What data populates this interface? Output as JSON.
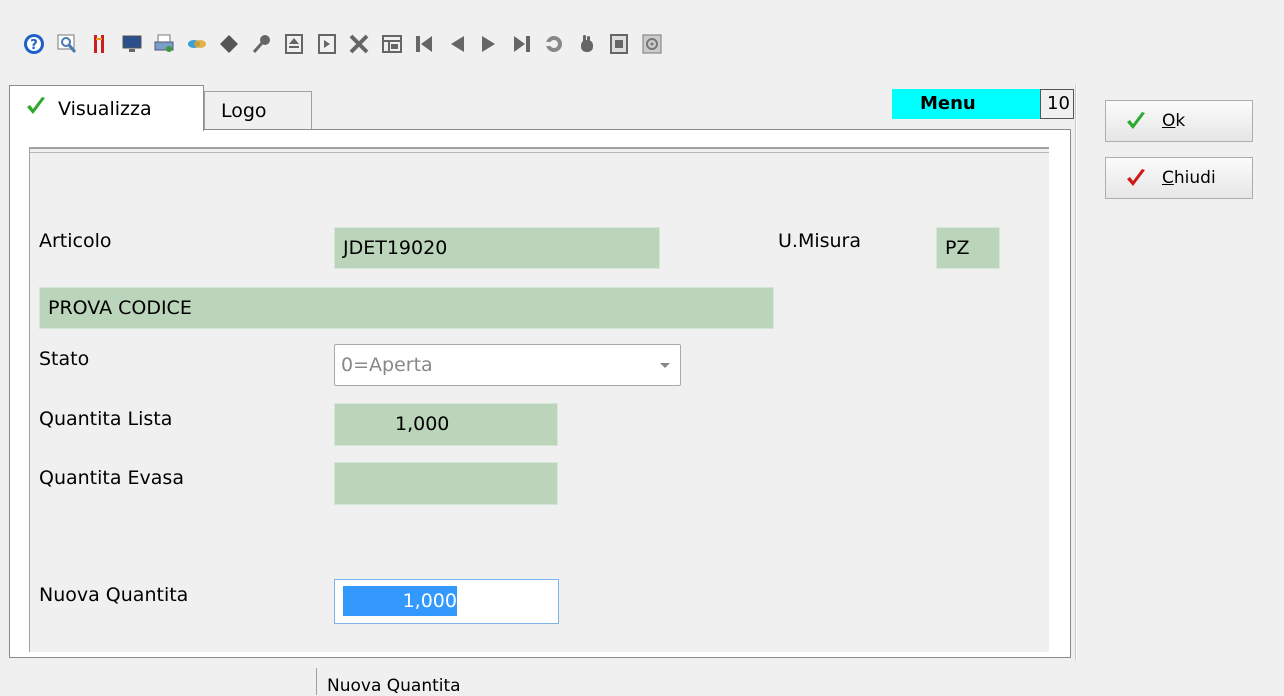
{
  "toolbar": {
    "icons": [
      "help-icon",
      "preview-icon",
      "bookmark-icon",
      "monitor-icon",
      "printer-icon",
      "link-icon",
      "diamond-icon",
      "search-key-icon",
      "eject-icon",
      "export-icon",
      "delete-icon",
      "table-icon",
      "first-record-icon",
      "previous-record-icon",
      "next-record-icon",
      "last-record-icon",
      "refresh-icon",
      "hand-icon",
      "document-icon",
      "settings-icon"
    ]
  },
  "tabs": {
    "active": "Visualizza",
    "inactive": "Logo"
  },
  "menu_badge": "Menu",
  "number_badge": "10",
  "form": {
    "articolo_label": "Articolo",
    "articolo_value": "JDET19020",
    "umisura_label": "U.Misura",
    "umisura_value": "PZ",
    "description_value": "PROVA CODICE",
    "stato_label": "Stato",
    "stato_value": "0=Aperta",
    "quantita_lista_label": "Quantita Lista",
    "quantita_lista_value": "1,000",
    "quantita_evasa_label": "Quantita Evasa",
    "quantita_evasa_value": "",
    "nuova_quantita_label": "Nuova Quantita",
    "nuova_quantita_value": "1,000"
  },
  "buttons": {
    "ok_mnemonic": "O",
    "ok_rest": "k",
    "chiudi_mnemonic": "C",
    "chiudi_rest": "hiudi"
  },
  "status_bar": {
    "text": "Nuova Quantita"
  },
  "colors": {
    "field_green": "#bad5ba",
    "menu_cyan": "#00ffff",
    "selection_blue": "#3399ff",
    "check_green": "#2ea82e",
    "check_red": "#d01818"
  }
}
